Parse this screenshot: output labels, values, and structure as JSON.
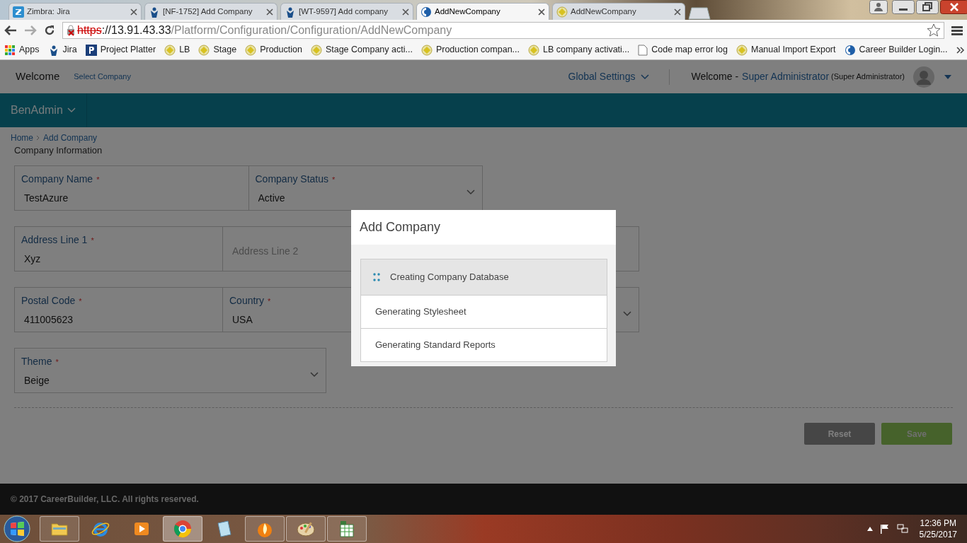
{
  "browser": {
    "tabs": [
      {
        "title": "Zimbra: Jira",
        "kind": "zimbra",
        "selected": false
      },
      {
        "title": "[NF-1752] Add Company",
        "kind": "jira",
        "selected": false
      },
      {
        "title": "[WT-9597] Add company",
        "kind": "jira",
        "selected": false
      },
      {
        "title": "AddNewCompany",
        "kind": "globe",
        "selected": true
      },
      {
        "title": "AddNewCompany",
        "kind": "coin",
        "selected": false
      }
    ],
    "url": {
      "scheme": "https",
      "host": "://13.91.43.33",
      "path": "/Platform/Configuration/Configuration/AddNewCompany"
    },
    "bookmarks": [
      {
        "label": "Apps",
        "kind": "apps"
      },
      {
        "label": "Jira",
        "kind": "jira"
      },
      {
        "label": "Project Platter",
        "kind": "letter"
      },
      {
        "label": "LB",
        "kind": "coin"
      },
      {
        "label": "Stage",
        "kind": "coin"
      },
      {
        "label": "Production",
        "kind": "coin"
      },
      {
        "label": "Stage Company acti...",
        "kind": "coin"
      },
      {
        "label": "Production compan...",
        "kind": "coin"
      },
      {
        "label": "LB company activati...",
        "kind": "coin"
      },
      {
        "label": "Code map error log",
        "kind": "page"
      },
      {
        "label": "Manual Import Export",
        "kind": "coin"
      },
      {
        "label": "Career Builder Login...",
        "kind": "globe"
      }
    ]
  },
  "header": {
    "welcome": "Welcome",
    "select_company": "Select Company",
    "global_settings": "Global Settings",
    "welcome_user": "Welcome -",
    "user_name": "Super Administrator",
    "user_role": "(Super Administrator)"
  },
  "nav": {
    "brand": "BenAdmin"
  },
  "breadcrumb": [
    "Home",
    "Add Company"
  ],
  "section_title": "Company Information",
  "form_rows": [
    [
      {
        "label": "Company Name",
        "required_mark": "*",
        "kind": "text",
        "value": "TestAzure"
      },
      {
        "label": "Company Status",
        "required_mark": "*",
        "kind": "select",
        "value": "Active"
      }
    ],
    [
      {
        "label": "Address Line 1",
        "required_mark": "*",
        "kind": "text",
        "value": "Xyz"
      },
      {
        "kind": "text",
        "placeholder": "Address Line 2"
      },
      {
        "kind": "text"
      }
    ],
    [
      {
        "label": "Postal Code",
        "required_mark": "*",
        "kind": "text",
        "value": "411005623"
      },
      {
        "label": "Country",
        "required_mark": "*",
        "kind": "select",
        "value": "USA"
      },
      {
        "kind": "select"
      }
    ],
    [
      {
        "label": "Theme",
        "required_mark": "*",
        "kind": "select",
        "value": "Beige"
      }
    ]
  ],
  "buttons": {
    "reset": "Reset",
    "save": "Save"
  },
  "footer": "© 2017 CareerBuilder, LLC. All rights reserved.",
  "modal": {
    "title": "Add Company",
    "steps": [
      {
        "label": "Creating Company Database",
        "active": true
      },
      {
        "label": "Generating Stylesheet",
        "active": false
      },
      {
        "label": "Generating Standard Reports",
        "active": false
      }
    ]
  },
  "taskbar": {
    "apps": [
      {
        "kind": "folder",
        "open": true,
        "selected": false
      },
      {
        "kind": "ie",
        "open": false,
        "selected": false
      },
      {
        "kind": "media",
        "open": false,
        "selected": false
      },
      {
        "kind": "chrome",
        "open": true,
        "selected": true
      },
      {
        "kind": "notepad",
        "open": false,
        "selected": false
      },
      {
        "kind": "flame",
        "open": true,
        "selected": false
      },
      {
        "kind": "paint",
        "open": true,
        "selected": false
      },
      {
        "kind": "sheet",
        "open": true,
        "selected": false
      }
    ],
    "time": "12:36 PM",
    "date": "5/25/2017"
  }
}
